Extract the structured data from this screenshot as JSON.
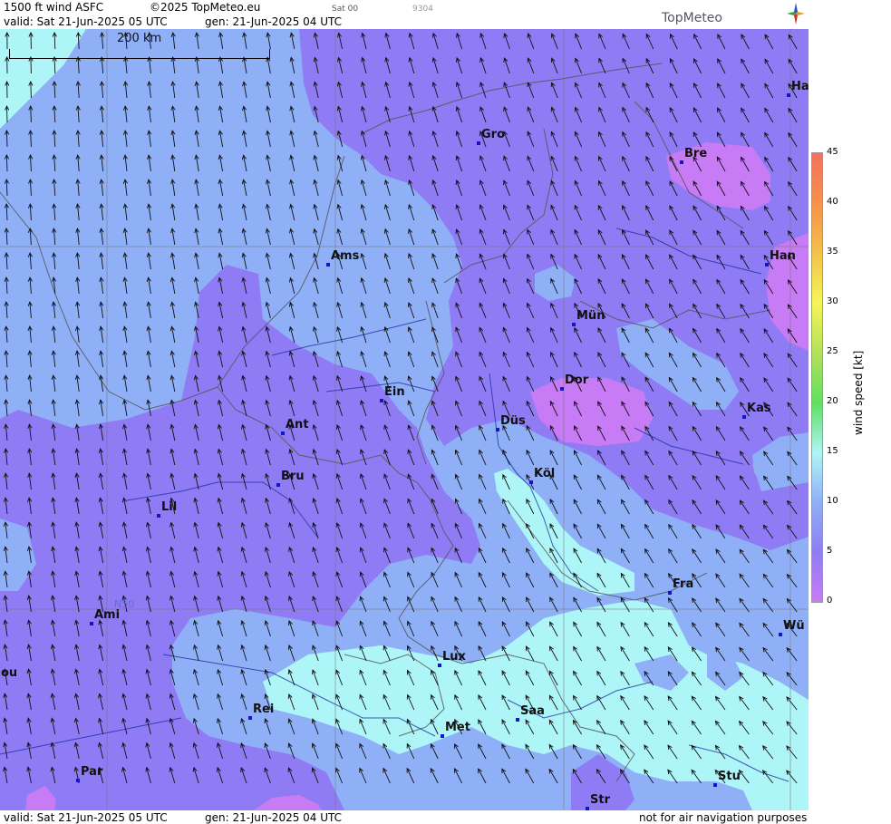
{
  "header": {
    "title": "1500 ft wind ASFC",
    "copyright": "©2025 TopMeteo.eu",
    "run": "Sat 00",
    "code": "9304",
    "valid": "valid:  Sat  21-Jun-2025  05 UTC",
    "gen": "gen: 21-Jun-2025 04 UTC",
    "logo": "TopMeteo"
  },
  "footer": {
    "valid": "valid:  Sat  21-Jun-2025  05 UTC",
    "gen": "gen: 21-Jun-2025 04 UTC",
    "disclaimer": "not for air navigation purposes"
  },
  "map": {
    "scale_label": "200 km",
    "lat_label": "N50",
    "cities": [
      {
        "name": "Ha"
      },
      {
        "name": "Gro"
      },
      {
        "name": "Bre"
      },
      {
        "name": "Ams"
      },
      {
        "name": "Han"
      },
      {
        "name": "Mün"
      },
      {
        "name": "Ein"
      },
      {
        "name": "Dor"
      },
      {
        "name": "Kas"
      },
      {
        "name": "Ant"
      },
      {
        "name": "Düs"
      },
      {
        "name": "Köl"
      },
      {
        "name": "Bru"
      },
      {
        "name": "Lil"
      },
      {
        "name": "Fra"
      },
      {
        "name": "Ami"
      },
      {
        "name": "Wü"
      },
      {
        "name": "Lux"
      },
      {
        "name": "ou"
      },
      {
        "name": "Rei"
      },
      {
        "name": "Saa"
      },
      {
        "name": "Met"
      },
      {
        "name": "Stu"
      },
      {
        "name": "Par"
      },
      {
        "name": "Str"
      }
    ]
  },
  "legend": {
    "ylabel": "wind speed [kt]",
    "ticks": [
      "45",
      "40",
      "35",
      "30",
      "25",
      "20",
      "15",
      "10",
      "5",
      "0"
    ],
    "stops": [
      {
        "value": 0,
        "color": "#c77cf5"
      },
      {
        "value": 5,
        "color": "#8f7cf5"
      },
      {
        "value": 10,
        "color": "#8fb0f7"
      },
      {
        "value": 15,
        "color": "#aef5f7"
      },
      {
        "value": 20,
        "color": "#5fe05f"
      },
      {
        "value": 25,
        "color": "#b5e05a"
      },
      {
        "value": 30,
        "color": "#f5f55a"
      },
      {
        "value": 35,
        "color": "#f5c04a"
      },
      {
        "value": 40,
        "color": "#f5924a"
      },
      {
        "value": 45,
        "color": "#f57060"
      }
    ]
  }
}
